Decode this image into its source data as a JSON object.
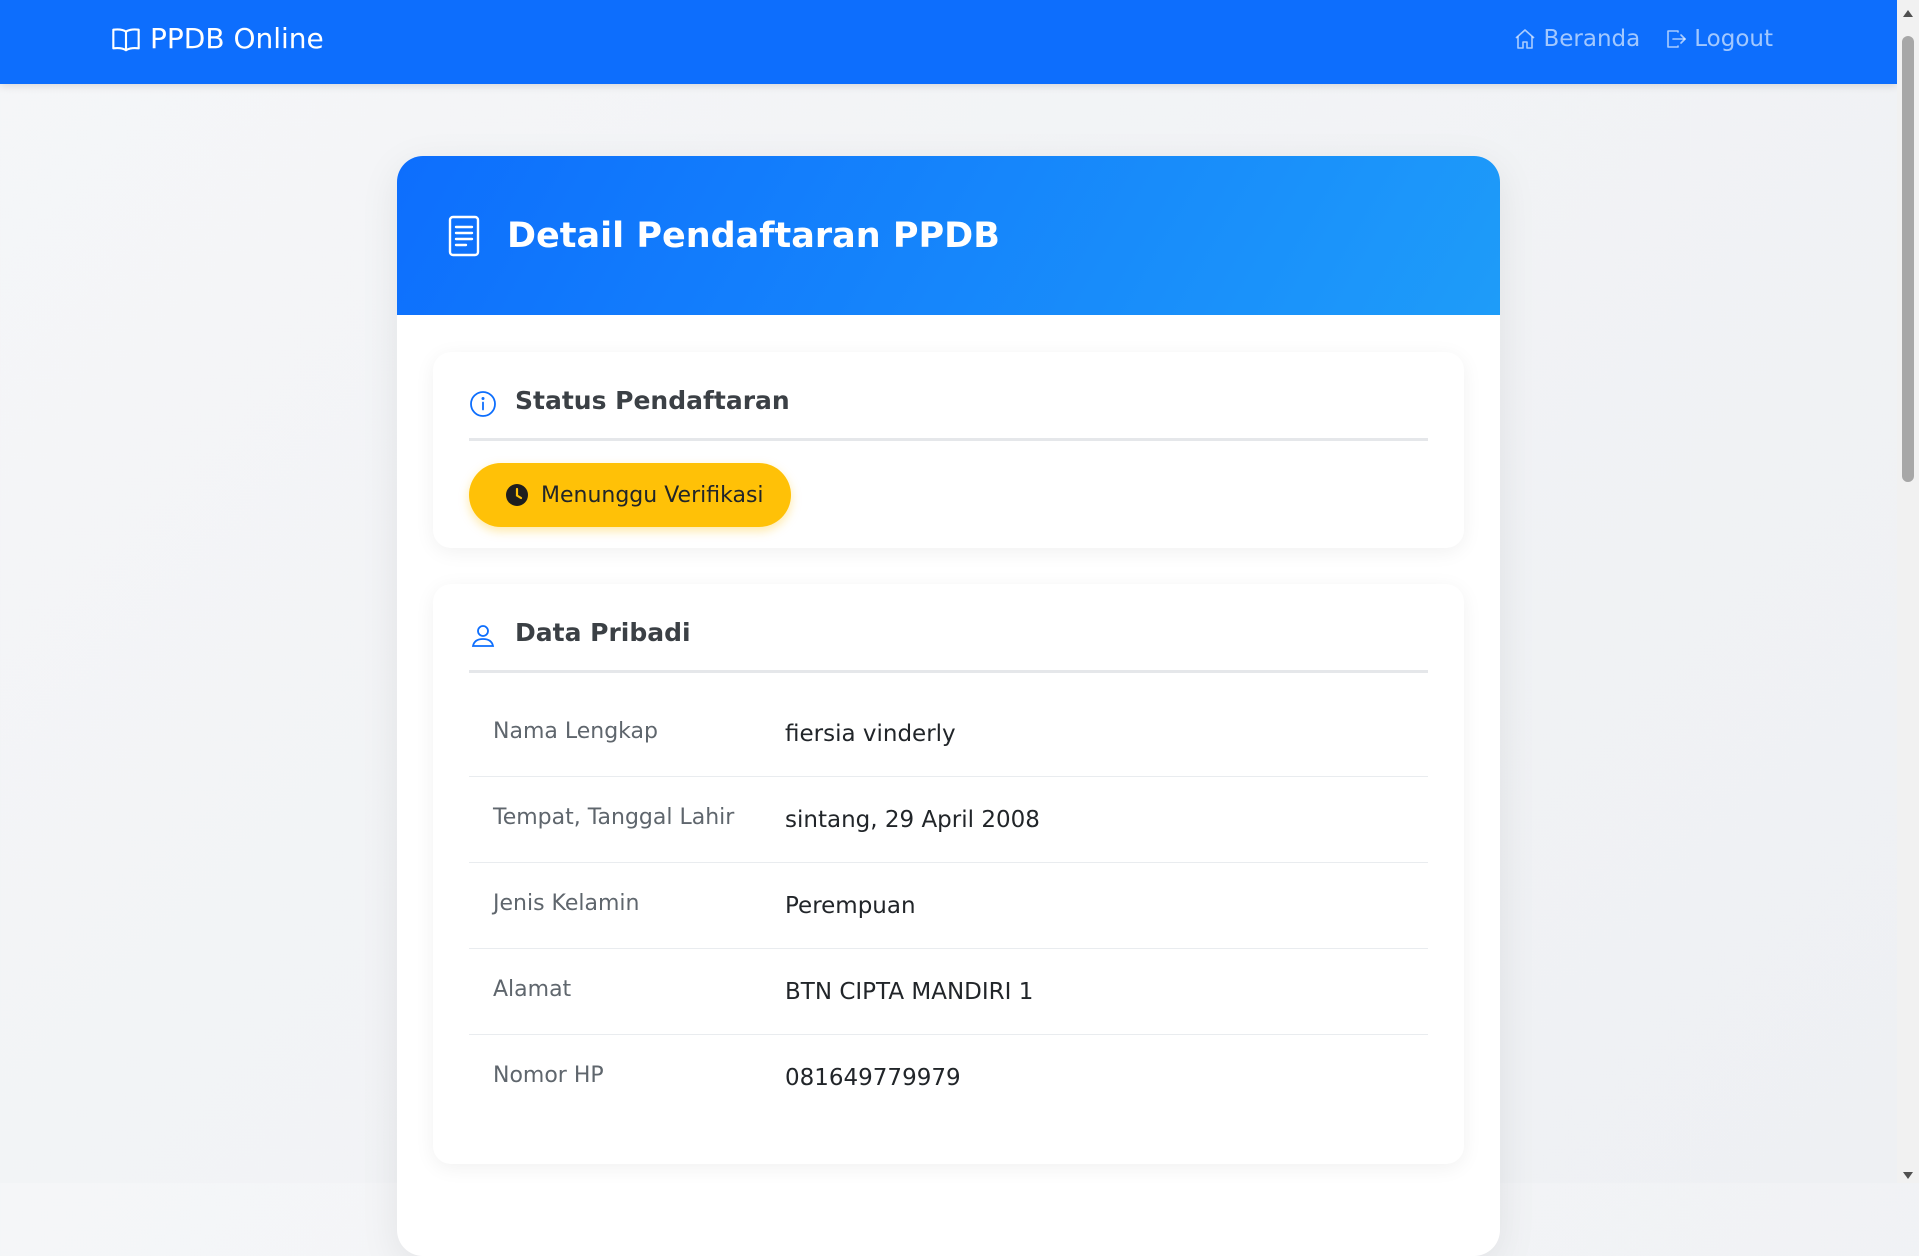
{
  "navbar": {
    "brand": "PPDB Online",
    "links": [
      {
        "label": "Beranda",
        "icon": "home-icon"
      },
      {
        "label": "Logout",
        "icon": "logout-icon"
      }
    ]
  },
  "card": {
    "title": "Detail Pendaftaran PPDB",
    "icon": "document-icon"
  },
  "status": {
    "title": "Status Pendaftaran",
    "badge": "Menunggu Verifikasi",
    "badge_color": "#ffc107"
  },
  "personal": {
    "title": "Data Pribadi",
    "rows": [
      {
        "label": "Nama Lengkap",
        "value": "fiersia vinderly"
      },
      {
        "label": "Tempat, Tanggal Lahir",
        "value": "sintang, 29 April 2008"
      },
      {
        "label": "Jenis Kelamin",
        "value": "Perempuan"
      },
      {
        "label": "Alamat",
        "value": "BTN CIPTA MANDIRI 1"
      },
      {
        "label": "Nomor HP",
        "value": "081649779979"
      }
    ]
  },
  "colors": {
    "primary": "#0d6efd",
    "header_gradient_end": "#1e9cf9",
    "warning": "#ffc107"
  }
}
